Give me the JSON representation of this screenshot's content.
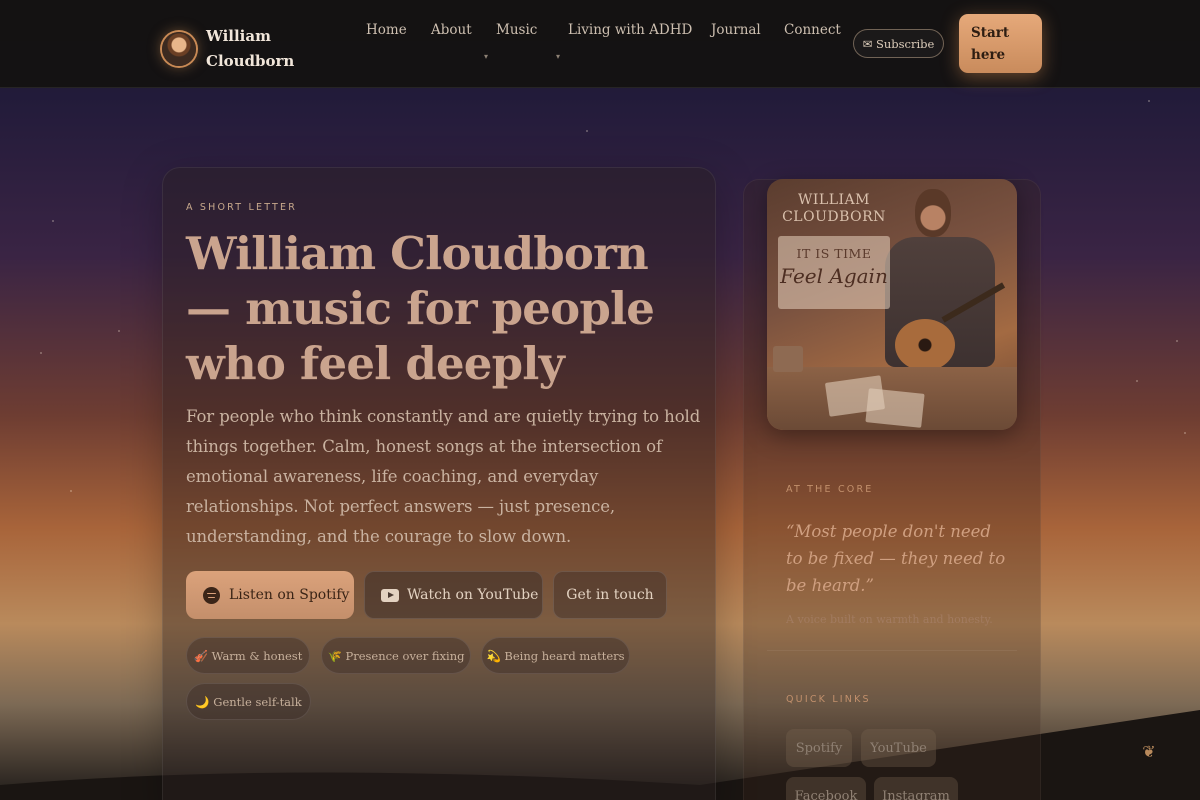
{
  "nav": {
    "brand_name": "William Cloudborn",
    "links": [
      {
        "label": "Home"
      },
      {
        "label": "About"
      },
      {
        "label": "Music"
      },
      {
        "label": "Living with ADHD"
      },
      {
        "label": "Journal"
      },
      {
        "label": "Connect"
      }
    ],
    "subscribe_label": "✉ Subscribe",
    "start_label": "Start here",
    "caret_glyph": "▾"
  },
  "hero": {
    "eyebrow": "A SHORT LETTER",
    "headline": "William Cloudborn — music for people who feel deeply",
    "lede": "For people who think constantly and are quietly trying to hold things together. Calm, honest songs at the intersection of emotional awareness, life coaching, and everyday relationships. Not perfect answers — just presence, understanding, and the courage to slow down.",
    "buttons": {
      "spotify": "Listen on Spotify",
      "youtube": "Watch on YouTube",
      "touch": "Get in touch"
    },
    "chips": [
      {
        "label": "🎻 Warm & honest"
      },
      {
        "label": "🌾 Presence over fixing"
      },
      {
        "label": "💫 Being heard matters"
      },
      {
        "label": "🌙 Gentle self-talk"
      }
    ]
  },
  "cover": {
    "artist": "WILLIAM CLOUDBORN",
    "banner_line1": "IT IS TIME",
    "banner_line2": "Feel Again"
  },
  "side": {
    "core_label": "AT THE CORE",
    "quote": "“Most people don't need to be fixed — they need to be heard.”",
    "quote_sub": "A voice built on warmth and honesty.",
    "quick_label": "QUICK LINKS",
    "quick_links": [
      {
        "label": "Spotify"
      },
      {
        "label": "YouTube"
      },
      {
        "label": "Facebook"
      },
      {
        "label": "Instagram"
      }
    ]
  },
  "floating_icon": "leaf-icon",
  "colors": {
    "accent": "#d9a07a",
    "background_dark": "#141212",
    "text_headline": "#caa48e"
  }
}
